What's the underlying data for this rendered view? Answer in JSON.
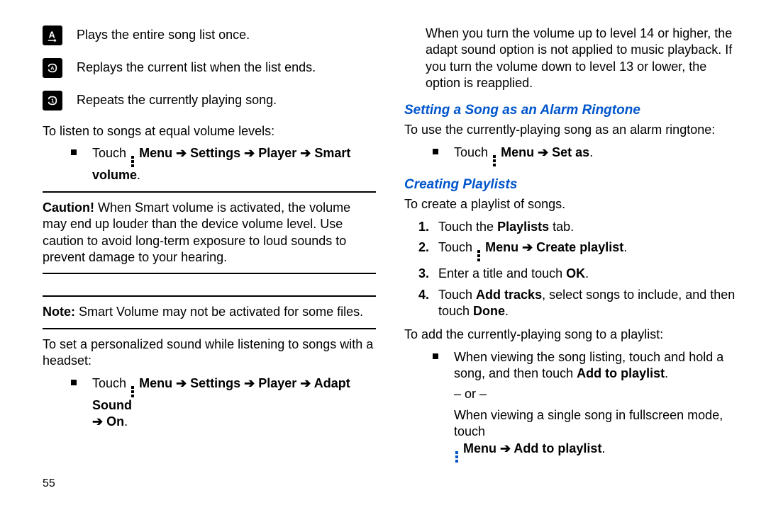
{
  "left": {
    "icons": [
      {
        "label": "Plays the entire song list once."
      },
      {
        "label": "Replays the current list when the list ends."
      },
      {
        "label": "Repeats the currently playing song."
      }
    ],
    "equal_volume_intro": "To listen to songs at equal volume levels:",
    "smart_volume_touch": "Touch",
    "smart_volume_path": "Menu ➔ Settings ➔ Player ➔ Smart volume",
    "caution_label": "Caution!",
    "caution_text": " When Smart volume is activated, the volume may end up louder than the device volume level. Use caution to avoid long-term exposure to loud sounds to prevent damage to your hearing.",
    "note_label": "Note:",
    "note_text": " Smart Volume may not be activated for some files.",
    "personalized_intro": "To set a personalized sound while listening to songs with a headset:",
    "adapt_touch": "Touch",
    "adapt_path_1": "Menu ➔ Settings ➔ Player ➔ Adapt Sound",
    "adapt_path_2": "➔ On",
    "period": "."
  },
  "right": {
    "volume_note": "When you turn the volume up to level 14 or higher, the adapt sound option is not applied to music playback. If you turn the volume down to level 13 or lower, the option is reapplied.",
    "section_alarm": "Setting a Song as an Alarm Ringtone",
    "alarm_intro": "To use the currently-playing song as an alarm ringtone:",
    "alarm_touch": "Touch",
    "alarm_path": "Menu ➔ Set as",
    "section_playlists": "Creating Playlists",
    "pl_intro": "To create a playlist of songs.",
    "pl_step1_a": "Touch the ",
    "pl_step1_b": "Playlists",
    "pl_step1_c": " tab.",
    "pl_step2_touch": "Touch",
    "pl_step2_path": "Menu ➔ Create playlist",
    "pl_step3_a": "Enter a title and touch ",
    "pl_step3_b": "OK",
    "pl_step4_a": "Touch ",
    "pl_step4_b": "Add tracks",
    "pl_step4_c": ", select songs to include, and then touch ",
    "pl_step4_d": "Done",
    "add_intro": "To add the currently-playing song to a playlist:",
    "add_bullet_a": "When viewing the song listing, touch and hold a song, and then touch ",
    "add_bullet_b": "Add to playlist",
    "or_text": "– or –",
    "add_full_a": "When viewing a single song in fullscreen mode, touch",
    "add_full_path": "Menu ➔ Add to playlist"
  },
  "page_number": "55"
}
